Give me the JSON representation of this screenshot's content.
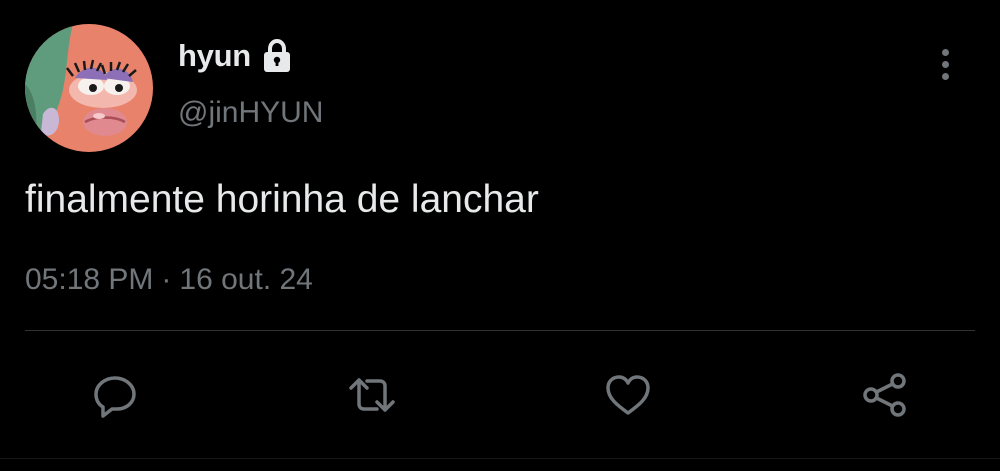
{
  "user": {
    "display_name": "hyun",
    "handle": "@jinHYUN",
    "locked_icon": "lock-icon"
  },
  "tweet": {
    "text": "finalmente horinha de lanchar",
    "time": "05:18 PM",
    "separator": "·",
    "date": "16 out. 24"
  },
  "actions": [
    {
      "name": "reply",
      "icon": "reply-icon"
    },
    {
      "name": "retweet",
      "icon": "retweet-icon"
    },
    {
      "name": "like",
      "icon": "heart-icon"
    },
    {
      "name": "share",
      "icon": "share-icon"
    }
  ],
  "colors": {
    "background": "#000000",
    "primary_text": "#e7e9ea",
    "secondary_text": "#71767b",
    "divider": "#2f3336"
  }
}
